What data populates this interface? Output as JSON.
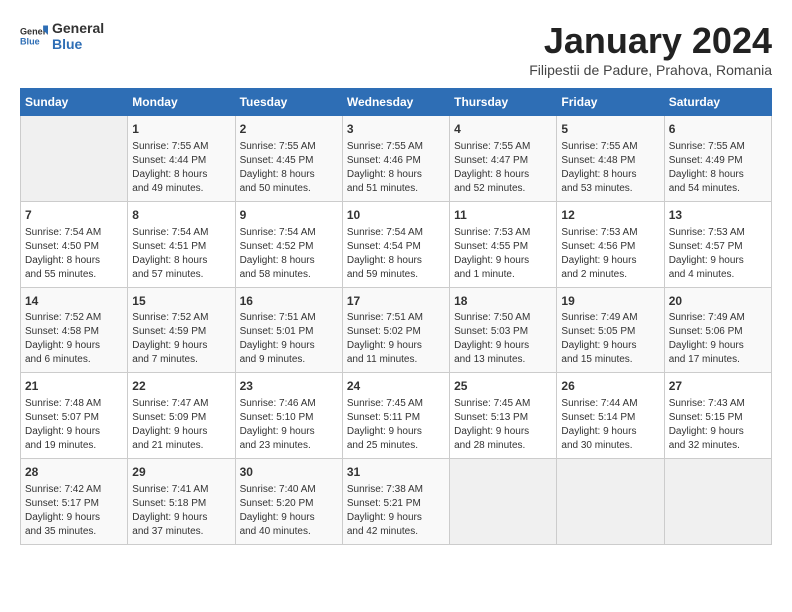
{
  "header": {
    "logo_line1": "General",
    "logo_line2": "Blue",
    "month": "January 2024",
    "location": "Filipestii de Padure, Prahova, Romania"
  },
  "days_of_week": [
    "Sunday",
    "Monday",
    "Tuesday",
    "Wednesday",
    "Thursday",
    "Friday",
    "Saturday"
  ],
  "weeks": [
    [
      {
        "day": "",
        "info": ""
      },
      {
        "day": "1",
        "info": "Sunrise: 7:55 AM\nSunset: 4:44 PM\nDaylight: 8 hours\nand 49 minutes."
      },
      {
        "day": "2",
        "info": "Sunrise: 7:55 AM\nSunset: 4:45 PM\nDaylight: 8 hours\nand 50 minutes."
      },
      {
        "day": "3",
        "info": "Sunrise: 7:55 AM\nSunset: 4:46 PM\nDaylight: 8 hours\nand 51 minutes."
      },
      {
        "day": "4",
        "info": "Sunrise: 7:55 AM\nSunset: 4:47 PM\nDaylight: 8 hours\nand 52 minutes."
      },
      {
        "day": "5",
        "info": "Sunrise: 7:55 AM\nSunset: 4:48 PM\nDaylight: 8 hours\nand 53 minutes."
      },
      {
        "day": "6",
        "info": "Sunrise: 7:55 AM\nSunset: 4:49 PM\nDaylight: 8 hours\nand 54 minutes."
      }
    ],
    [
      {
        "day": "7",
        "info": "Sunrise: 7:54 AM\nSunset: 4:50 PM\nDaylight: 8 hours\nand 55 minutes."
      },
      {
        "day": "8",
        "info": "Sunrise: 7:54 AM\nSunset: 4:51 PM\nDaylight: 8 hours\nand 57 minutes."
      },
      {
        "day": "9",
        "info": "Sunrise: 7:54 AM\nSunset: 4:52 PM\nDaylight: 8 hours\nand 58 minutes."
      },
      {
        "day": "10",
        "info": "Sunrise: 7:54 AM\nSunset: 4:54 PM\nDaylight: 8 hours\nand 59 minutes."
      },
      {
        "day": "11",
        "info": "Sunrise: 7:53 AM\nSunset: 4:55 PM\nDaylight: 9 hours\nand 1 minute."
      },
      {
        "day": "12",
        "info": "Sunrise: 7:53 AM\nSunset: 4:56 PM\nDaylight: 9 hours\nand 2 minutes."
      },
      {
        "day": "13",
        "info": "Sunrise: 7:53 AM\nSunset: 4:57 PM\nDaylight: 9 hours\nand 4 minutes."
      }
    ],
    [
      {
        "day": "14",
        "info": "Sunrise: 7:52 AM\nSunset: 4:58 PM\nDaylight: 9 hours\nand 6 minutes."
      },
      {
        "day": "15",
        "info": "Sunrise: 7:52 AM\nSunset: 4:59 PM\nDaylight: 9 hours\nand 7 minutes."
      },
      {
        "day": "16",
        "info": "Sunrise: 7:51 AM\nSunset: 5:01 PM\nDaylight: 9 hours\nand 9 minutes."
      },
      {
        "day": "17",
        "info": "Sunrise: 7:51 AM\nSunset: 5:02 PM\nDaylight: 9 hours\nand 11 minutes."
      },
      {
        "day": "18",
        "info": "Sunrise: 7:50 AM\nSunset: 5:03 PM\nDaylight: 9 hours\nand 13 minutes."
      },
      {
        "day": "19",
        "info": "Sunrise: 7:49 AM\nSunset: 5:05 PM\nDaylight: 9 hours\nand 15 minutes."
      },
      {
        "day": "20",
        "info": "Sunrise: 7:49 AM\nSunset: 5:06 PM\nDaylight: 9 hours\nand 17 minutes."
      }
    ],
    [
      {
        "day": "21",
        "info": "Sunrise: 7:48 AM\nSunset: 5:07 PM\nDaylight: 9 hours\nand 19 minutes."
      },
      {
        "day": "22",
        "info": "Sunrise: 7:47 AM\nSunset: 5:09 PM\nDaylight: 9 hours\nand 21 minutes."
      },
      {
        "day": "23",
        "info": "Sunrise: 7:46 AM\nSunset: 5:10 PM\nDaylight: 9 hours\nand 23 minutes."
      },
      {
        "day": "24",
        "info": "Sunrise: 7:45 AM\nSunset: 5:11 PM\nDaylight: 9 hours\nand 25 minutes."
      },
      {
        "day": "25",
        "info": "Sunrise: 7:45 AM\nSunset: 5:13 PM\nDaylight: 9 hours\nand 28 minutes."
      },
      {
        "day": "26",
        "info": "Sunrise: 7:44 AM\nSunset: 5:14 PM\nDaylight: 9 hours\nand 30 minutes."
      },
      {
        "day": "27",
        "info": "Sunrise: 7:43 AM\nSunset: 5:15 PM\nDaylight: 9 hours\nand 32 minutes."
      }
    ],
    [
      {
        "day": "28",
        "info": "Sunrise: 7:42 AM\nSunset: 5:17 PM\nDaylight: 9 hours\nand 35 minutes."
      },
      {
        "day": "29",
        "info": "Sunrise: 7:41 AM\nSunset: 5:18 PM\nDaylight: 9 hours\nand 37 minutes."
      },
      {
        "day": "30",
        "info": "Sunrise: 7:40 AM\nSunset: 5:20 PM\nDaylight: 9 hours\nand 40 minutes."
      },
      {
        "day": "31",
        "info": "Sunrise: 7:38 AM\nSunset: 5:21 PM\nDaylight: 9 hours\nand 42 minutes."
      },
      {
        "day": "",
        "info": ""
      },
      {
        "day": "",
        "info": ""
      },
      {
        "day": "",
        "info": ""
      }
    ]
  ]
}
